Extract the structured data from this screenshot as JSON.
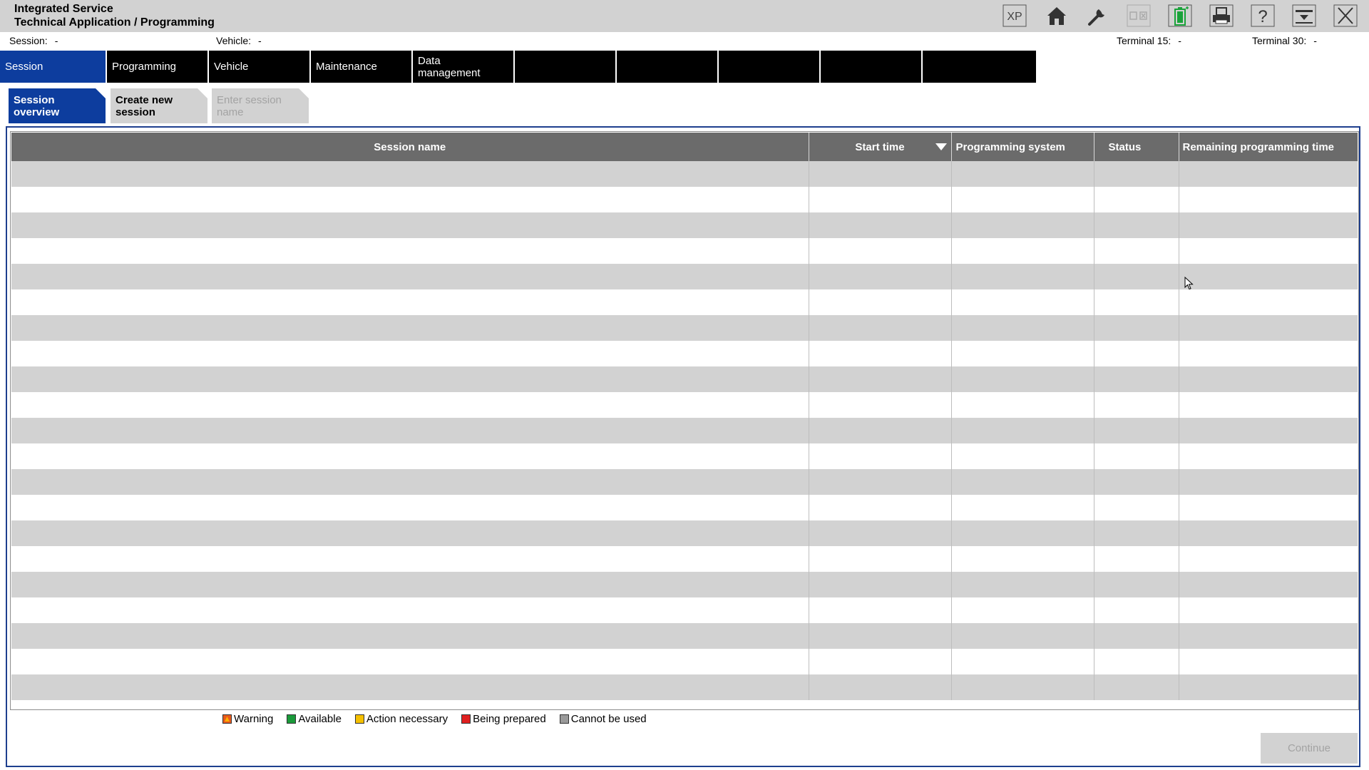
{
  "header": {
    "title_line1": "Integrated Service",
    "title_line2": "Technical Application / Programming",
    "toolbar": [
      {
        "name": "xp-button",
        "icon": "xp-text",
        "label": "XP"
      },
      {
        "name": "home-button",
        "icon": "home-icon"
      },
      {
        "name": "service-button",
        "icon": "wrench-icon"
      },
      {
        "name": "connection-button",
        "icon": "connection-icon",
        "disabled": true
      },
      {
        "name": "battery-button",
        "icon": "battery-icon",
        "color": "#1aa33a"
      },
      {
        "name": "print-button",
        "icon": "print-icon"
      },
      {
        "name": "help-button",
        "icon": "help-icon"
      },
      {
        "name": "minimize-button",
        "icon": "minimize-icon"
      },
      {
        "name": "close-button",
        "icon": "close-icon"
      }
    ]
  },
  "infobar": {
    "session_label": "Session:",
    "session_value": "-",
    "vehicle_label": "Vehicle:",
    "vehicle_value": "-",
    "terminal15_label": "Terminal 15:",
    "terminal15_value": "-",
    "terminal30_label": "Terminal 30:",
    "terminal30_value": "-"
  },
  "main_nav": [
    {
      "label": "Session",
      "active": true
    },
    {
      "label": "Programming"
    },
    {
      "label": "Vehicle"
    },
    {
      "label": "Maintenance"
    },
    {
      "label": "Data management"
    },
    {
      "label": ""
    },
    {
      "label": ""
    },
    {
      "label": ""
    },
    {
      "label": ""
    },
    {
      "label": ""
    }
  ],
  "sub_tabs": [
    {
      "label": "Session overview",
      "state": "active"
    },
    {
      "label": "Create new session",
      "state": "normal"
    },
    {
      "label": "Enter session name",
      "state": "disabled"
    }
  ],
  "table": {
    "columns": [
      "Session name",
      "Start time",
      "Programming system",
      "Status",
      "Remaining programming time"
    ],
    "sort_column": "Start time",
    "rows": []
  },
  "legend": [
    {
      "label": "Warning",
      "color": "#e85a1c"
    },
    {
      "label": "Available",
      "color": "#1a9a3a"
    },
    {
      "label": "Action necessary",
      "color": "#f5c000"
    },
    {
      "label": "Being prepared",
      "color": "#e02020"
    },
    {
      "label": "Cannot be used",
      "color": "#9a9a9a"
    }
  ],
  "footer": {
    "continue_label": "Continue"
  },
  "colors": {
    "accent": "#0d3d9e",
    "nav_bg": "#000000",
    "header_bg": "#d2d2d2",
    "table_header": "#6b6b6b"
  }
}
